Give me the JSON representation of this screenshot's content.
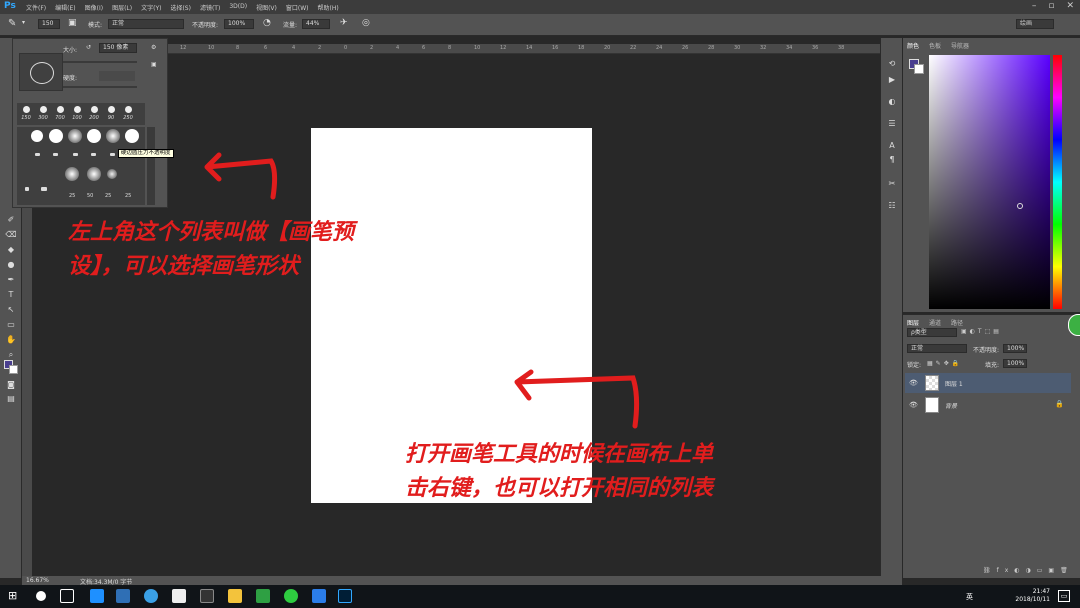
{
  "app": {
    "logo": "Ps"
  },
  "menu": [
    "文件(F)",
    "编辑(E)",
    "图像(I)",
    "图层(L)",
    "文字(Y)",
    "选择(S)",
    "滤镜(T)",
    "3D(D)",
    "视图(V)",
    "窗口(W)",
    "帮助(H)"
  ],
  "window_controls": [
    "–",
    "▫",
    "✕"
  ],
  "options_bar": {
    "brush_size": "150",
    "mode_label": "模式:",
    "mode_value": "正常",
    "opacity_label": "不透明度:",
    "opacity_value": "100%",
    "flow_label": "流量:",
    "flow_value": "44%",
    "workspace": "绘画"
  },
  "ruler_ticks": [
    "12",
    "10",
    "8",
    "6",
    "4",
    "2",
    "0",
    "2",
    "4",
    "6",
    "8",
    "10",
    "12",
    "14",
    "16",
    "18",
    "20",
    "22",
    "24",
    "26",
    "28",
    "30",
    "32",
    "34",
    "36",
    "38"
  ],
  "brush_panel": {
    "size_label": "大小:",
    "size_value": "150 像素",
    "hardness_label": "硬度:",
    "recent_sizes": [
      "150",
      "300",
      "700",
      "100",
      "200",
      "90",
      "250"
    ],
    "preset_numbers": [
      "25",
      "50",
      "25",
      "25"
    ],
    "tooltip": "硬边圆压力不透明度"
  },
  "color_panel": {
    "tabs": [
      "颜色",
      "色板",
      "导航器"
    ],
    "fg_color": "#4a3f8f",
    "bg_color": "#ffffff"
  },
  "layers_panel": {
    "tabs": [
      "图层",
      "通道",
      "路径"
    ],
    "filter_label": "ρ类型",
    "blend_mode": "正常",
    "opacity_label": "不透明度:",
    "opacity_value": "100%",
    "lock_label": "锁定:",
    "fill_label": "填充:",
    "fill_value": "100%",
    "layers": [
      {
        "name": "图层 1",
        "selected": true
      },
      {
        "name": "背景",
        "selected": false
      }
    ]
  },
  "status": {
    "zoom": "16.67%",
    "doc": "文档:34.3M/0 字节"
  },
  "annotations": {
    "left_line1": "左上角这个列表叫做【画笔预",
    "left_line2": "设】，可以选择画笔形状",
    "right_line1": "打开画笔工具的时候在画布上单",
    "right_line2": "击右键，也可以打开相同的列表"
  },
  "taskbar": {
    "lang": "英",
    "time": "21:47",
    "date": "2018/10/11"
  }
}
